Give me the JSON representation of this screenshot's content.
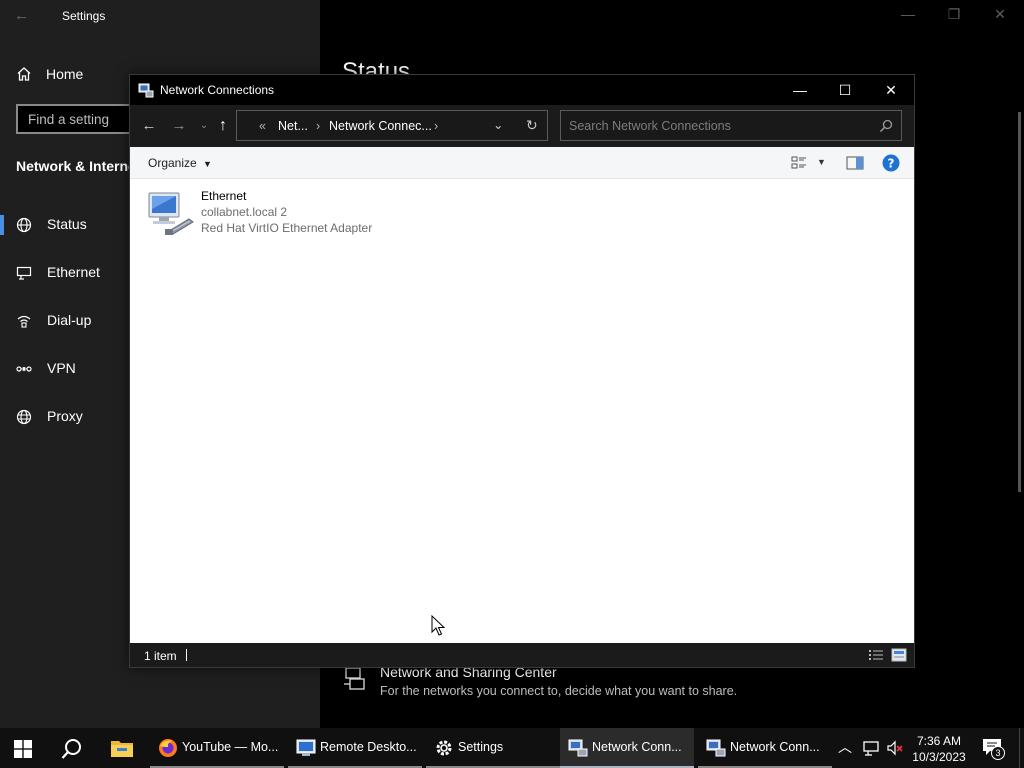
{
  "settings": {
    "title": "Settings",
    "home": "Home",
    "search_placeholder": "Find a setting",
    "section": "Network & Internet",
    "nav": [
      {
        "label": "Status"
      },
      {
        "label": "Ethernet"
      },
      {
        "label": "Dial-up"
      },
      {
        "label": "VPN"
      },
      {
        "label": "Proxy"
      }
    ],
    "page_title": "Status",
    "sharing": {
      "title": "Network and Sharing Center",
      "desc": "For the networks you connect to, decide what you want to share."
    }
  },
  "explorer": {
    "title": "Network Connections",
    "breadcrumb": {
      "overflow": "«",
      "seg1": "Net...",
      "seg2": "Network Connec..."
    },
    "search_placeholder": "Search Network Connections",
    "organize": "Organize",
    "items": [
      {
        "name": "Ethernet",
        "domain": "collabnet.local 2",
        "device": "Red Hat VirtIO Ethernet Adapter"
      }
    ],
    "status_count": "1 item"
  },
  "taskbar": {
    "apps": [
      {
        "label": "YouTube — Mo...",
        "icon": "firefox-icon"
      },
      {
        "label": "Remote Deskto...",
        "icon": "remote-desktop-icon"
      },
      {
        "label": "Settings",
        "icon": "gear-icon"
      },
      {
        "label": "Network Conn...",
        "icon": "network-connections-icon"
      },
      {
        "label": "Network Conn...",
        "icon": "network-connections-icon"
      }
    ],
    "time": "7:36 AM",
    "date": "10/3/2023",
    "notifications": "3"
  },
  "colors": {
    "accent": "#4a90e2",
    "help": "#1e73d2"
  }
}
